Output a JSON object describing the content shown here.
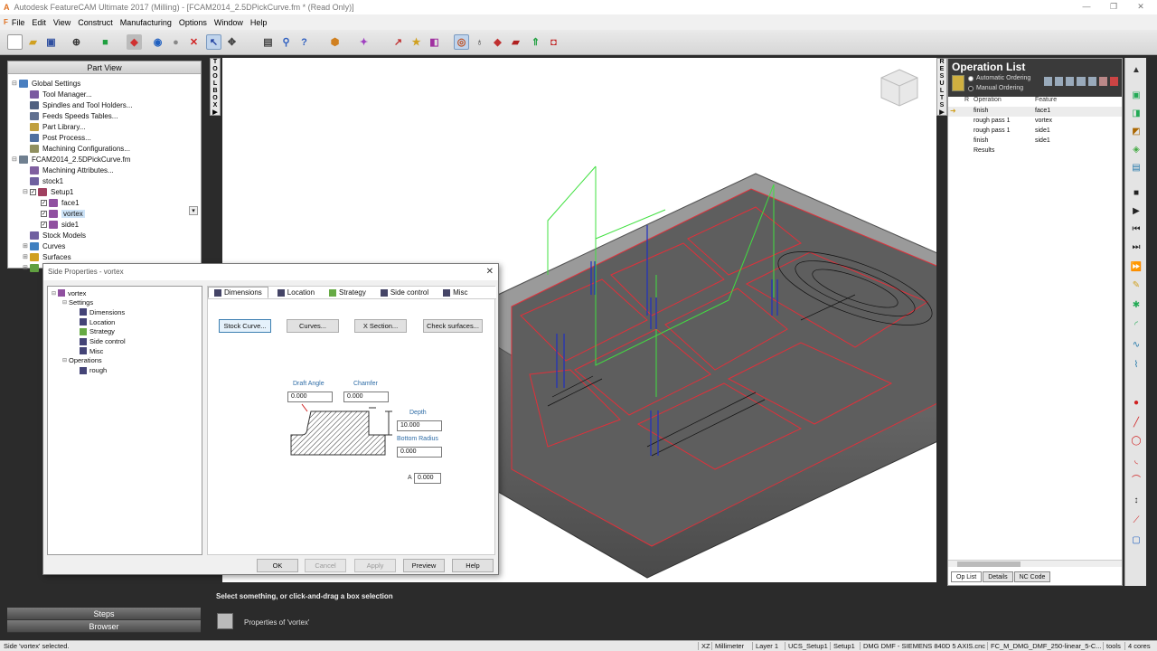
{
  "window": {
    "title": "Autodesk FeatureCAM Ultimate 2017 (Milling) - [FCAM2014_2.5DPickCurve.fm * (Read Only)]",
    "app_logo": "A",
    "controls": [
      "—",
      "❐",
      "✕"
    ]
  },
  "menubar": {
    "icon": "F",
    "items": [
      "File",
      "Edit",
      "View",
      "Construct",
      "Manufacturing",
      "Options",
      "Window",
      "Help"
    ]
  },
  "part_view": {
    "title": "Part View",
    "tree": [
      {
        "label": "Global Settings",
        "depth": 0,
        "expander": "⊟",
        "color": "#4a7fc0"
      },
      {
        "label": "Tool Manager...",
        "depth": 1,
        "expander": "",
        "color": "#7a5aa0"
      },
      {
        "label": "Spindles and Tool Holders...",
        "depth": 1,
        "expander": "",
        "color": "#506080"
      },
      {
        "label": "Feeds  Speeds Tables...",
        "depth": 1,
        "expander": "",
        "color": "#607090"
      },
      {
        "label": "Part Library...",
        "depth": 1,
        "expander": "",
        "color": "#c0a040"
      },
      {
        "label": "Post Process...",
        "depth": 1,
        "expander": "",
        "color": "#5070a0"
      },
      {
        "label": "Machining Configurations...",
        "depth": 1,
        "expander": "",
        "color": "#909060"
      },
      {
        "label": "FCAM2014_2.5DPickCurve.fm",
        "depth": 0,
        "expander": "⊟",
        "color": "#708090"
      },
      {
        "label": "Machining Attributes...",
        "depth": 1,
        "expander": "",
        "color": "#8060a0"
      },
      {
        "label": "stock1",
        "depth": 1,
        "expander": "",
        "color": "#7060a0"
      },
      {
        "label": "Setup1",
        "depth": 1,
        "expander": "⊟",
        "color": "#a04060",
        "check": true
      },
      {
        "label": "face1",
        "depth": 2,
        "expander": "",
        "color": "#9050a0",
        "check": true
      },
      {
        "label": "vortex",
        "depth": 2,
        "expander": "",
        "color": "#9050a0",
        "check": true,
        "selected": true
      },
      {
        "label": "side1",
        "depth": 2,
        "expander": "",
        "color": "#9050a0",
        "check": true
      },
      {
        "label": "Stock Models",
        "depth": 1,
        "expander": "",
        "color": "#7060a0"
      },
      {
        "label": "Curves",
        "depth": 1,
        "expander": "⊞",
        "color": "#4080c0"
      },
      {
        "label": "Surfaces",
        "depth": 1,
        "expander": "⊞",
        "color": "#d0a020"
      },
      {
        "label": "Sol",
        "depth": 1,
        "expander": "⊞",
        "color": "#60a040"
      }
    ]
  },
  "left_bottom": {
    "steps": "Steps",
    "browser": "Browser"
  },
  "toolbox_label": [
    "T",
    "O",
    "O",
    "L",
    "B",
    "O",
    "X",
    "▶"
  ],
  "results_label": [
    "R",
    "E",
    "S",
    "U",
    "L",
    "T",
    "S",
    "▶"
  ],
  "dialog": {
    "title": "Side Properties - vortex",
    "close": "✕",
    "tree": [
      {
        "label": "vortex",
        "depth": 0,
        "expander": "⊟",
        "color": "#9050a0"
      },
      {
        "label": "Settings",
        "depth": 1,
        "expander": "⊟",
        "color": ""
      },
      {
        "label": "Dimensions",
        "depth": 2,
        "expander": "",
        "color": "#447"
      },
      {
        "label": "Location",
        "depth": 2,
        "expander": "",
        "color": "#447"
      },
      {
        "label": "Strategy",
        "depth": 2,
        "expander": "",
        "color": "#6a4"
      },
      {
        "label": "Side control",
        "depth": 2,
        "expander": "",
        "color": "#447"
      },
      {
        "label": "Misc",
        "depth": 2,
        "expander": "",
        "color": "#447"
      },
      {
        "label": "Operations",
        "depth": 1,
        "expander": "⊟",
        "color": ""
      },
      {
        "label": "rough",
        "depth": 2,
        "expander": "",
        "color": "#447"
      }
    ],
    "tabs": [
      "Dimensions",
      "Location",
      "Strategy",
      "Side control",
      "Misc"
    ],
    "buttons": {
      "stock_curve": "Stock Curve...",
      "curves": "Curves...",
      "x_section": "X Section...",
      "check_surfaces": "Check surfaces..."
    },
    "fields": {
      "draft_angle_label": "Draft Angle",
      "draft_angle": "0.000",
      "chamfer_label": "Chamfer",
      "chamfer": "0.000",
      "depth_label": "Depth",
      "depth": "10.000",
      "bottom_radius_label": "Bottom Radius",
      "bottom_radius": "0.000",
      "a_label": "A",
      "a_value": "0.000"
    },
    "footer": {
      "ok": "OK",
      "cancel": "Cancel",
      "apply": "Apply",
      "preview": "Preview",
      "help": "Help"
    }
  },
  "op_list": {
    "title": "Operation List",
    "ordering": [
      "Automatic Ordering",
      "Manual Ordering"
    ],
    "headers": {
      "r": "R",
      "operation": "Operation",
      "feature": "Feature"
    },
    "rows": [
      {
        "operation": "finish",
        "feature": "face1",
        "current": true
      },
      {
        "operation": "rough pass 1",
        "feature": "vortex",
        "current": false
      },
      {
        "operation": "rough pass 1",
        "feature": "side1",
        "current": false
      },
      {
        "operation": "finish",
        "feature": "side1",
        "current": false
      },
      {
        "operation": "Results",
        "feature": "",
        "current": false
      }
    ],
    "tabs": [
      "Op List",
      "Details",
      "NC Code"
    ]
  },
  "prompt": "Select something, or click-and-drag a box selection",
  "properties_text": "Properties of 'vortex'",
  "statusbar": {
    "left": "Side 'vortex' selected.",
    "segments": [
      "XZ",
      "Millimeter",
      "Layer 1",
      "UCS_Setup1",
      "Setup1",
      "DMG DMF - SIEMENS 840D 5 AXIS.cnc",
      "FC_M_DMG_DMF_250-linear_5-C...",
      "tools",
      "4 cores"
    ]
  },
  "colors": {
    "accent_orange": "#e07020",
    "edge_red": "#e0303a",
    "toolpath_blue": "#2030c0",
    "toolpath_green": "#40e040",
    "part_gray": "#6a6a6a"
  }
}
